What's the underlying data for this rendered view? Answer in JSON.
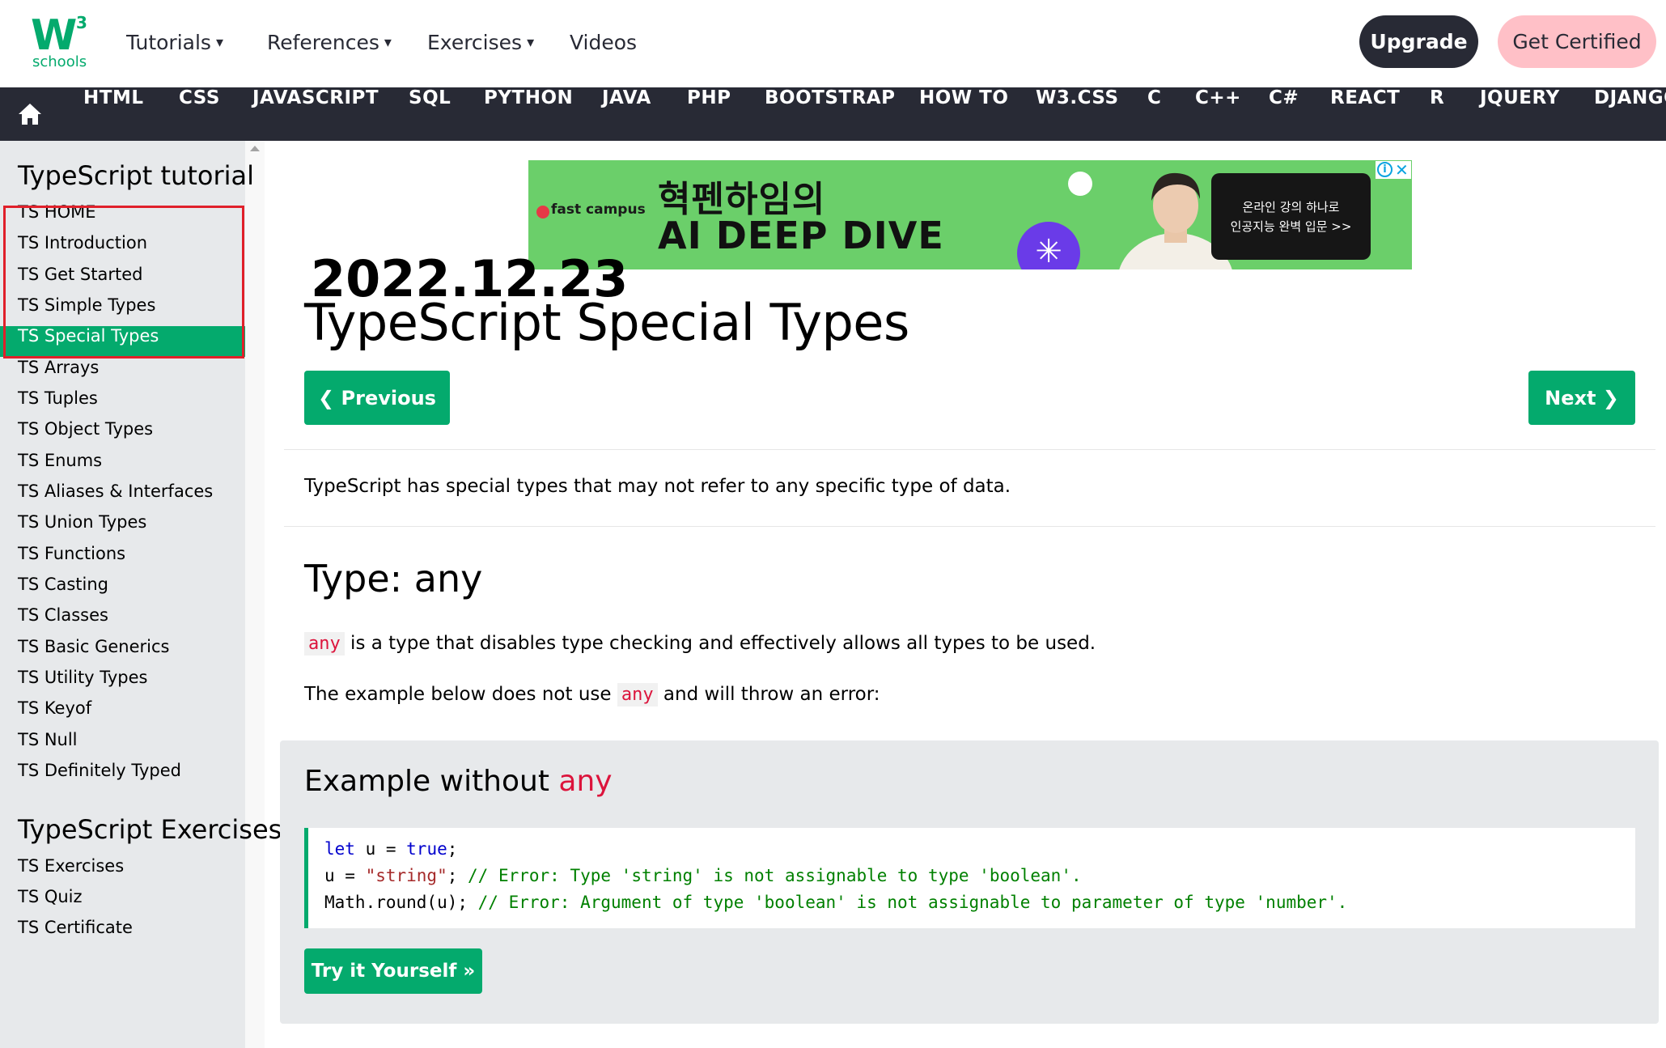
{
  "logo": {
    "mark": "W",
    "superscript": "3",
    "text": "schools"
  },
  "topnav": [
    {
      "label": "Tutorials",
      "caret": "▾"
    },
    {
      "label": "References",
      "caret": "▾"
    },
    {
      "label": "Exercises",
      "caret": "▾"
    },
    {
      "label": "Videos",
      "caret": ""
    }
  ],
  "header_buttons": {
    "upgrade": "Upgrade",
    "get_certified": "Get Certified"
  },
  "subnav": [
    "HTML",
    "CSS",
    "JAVASCRIPT",
    "SQL",
    "PYTHON",
    "JAVA",
    "PHP",
    "BOOTSTRAP",
    "HOW TO",
    "W3.CSS",
    "C",
    "C++",
    "C#",
    "REACT",
    "R",
    "JQUERY",
    "DJANGO"
  ],
  "sidebar": {
    "heading": "TypeScript tutorial",
    "items": [
      "TS HOME",
      "TS Introduction",
      "TS Get Started",
      "TS Simple Types",
      "TS Special Types",
      "TS Arrays",
      "TS Tuples",
      "TS Object Types",
      "TS Enums",
      "TS Aliases & Interfaces",
      "TS Union Types",
      "TS Functions",
      "TS Casting",
      "TS Classes",
      "TS Basic Generics",
      "TS Utility Types",
      "TS Keyof",
      "TS Null",
      "TS Definitely Typed"
    ],
    "active_index": 4,
    "exercises_heading": "TypeScript Exercises",
    "exercise_items": [
      "TS Exercises",
      "TS Quiz",
      "TS Certificate"
    ]
  },
  "ad": {
    "brand": "fast campus",
    "headline_line1": "혁펜하임의",
    "headline_line2": "AI DEEP DIVE",
    "cta_line1": "온라인 강의 하나로",
    "cta_line2": "인공지능 완벽 입문 >>",
    "info_glyph": "i",
    "close_glyph": "✕"
  },
  "stamp_date": "2022.12.23",
  "page_title": "TypeScript Special Types",
  "nav": {
    "previous": "❮ Previous",
    "next": "Next ❯"
  },
  "intro": "TypeScript has special types that may not refer to any specific type of data.",
  "section_heading": "Type: any",
  "para1": {
    "code": "any",
    "text": " is a type that disables type checking and effectively allows all types to be used."
  },
  "para2": {
    "before": "The example below does not use ",
    "code": "any",
    "after": " and will throw an error:"
  },
  "example": {
    "heading_prefix": "Example without ",
    "heading_keyword": "any",
    "code_lines": [
      [
        {
          "t": "let",
          "c": "kw"
        },
        {
          "t": " u = ",
          "c": ""
        },
        {
          "t": "true",
          "c": "kw"
        },
        {
          "t": ";",
          "c": ""
        }
      ],
      [
        {
          "t": "u = ",
          "c": ""
        },
        {
          "t": "\"string\"",
          "c": "str"
        },
        {
          "t": "; ",
          "c": ""
        },
        {
          "t": "// Error: Type 'string' is not assignable to type 'boolean'.",
          "c": "cmt"
        }
      ],
      [
        {
          "t": "Math.round(u); ",
          "c": ""
        },
        {
          "t": "// Error: Argument of type 'boolean' is not assignable to parameter of type 'number'.",
          "c": "cmt"
        }
      ]
    ],
    "try_button": "Try it Yourself »"
  },
  "colors": {
    "accent": "#04AA6D",
    "dark": "#282A35",
    "highlight_box": "#E0202A",
    "keyword": "#DC143C"
  }
}
